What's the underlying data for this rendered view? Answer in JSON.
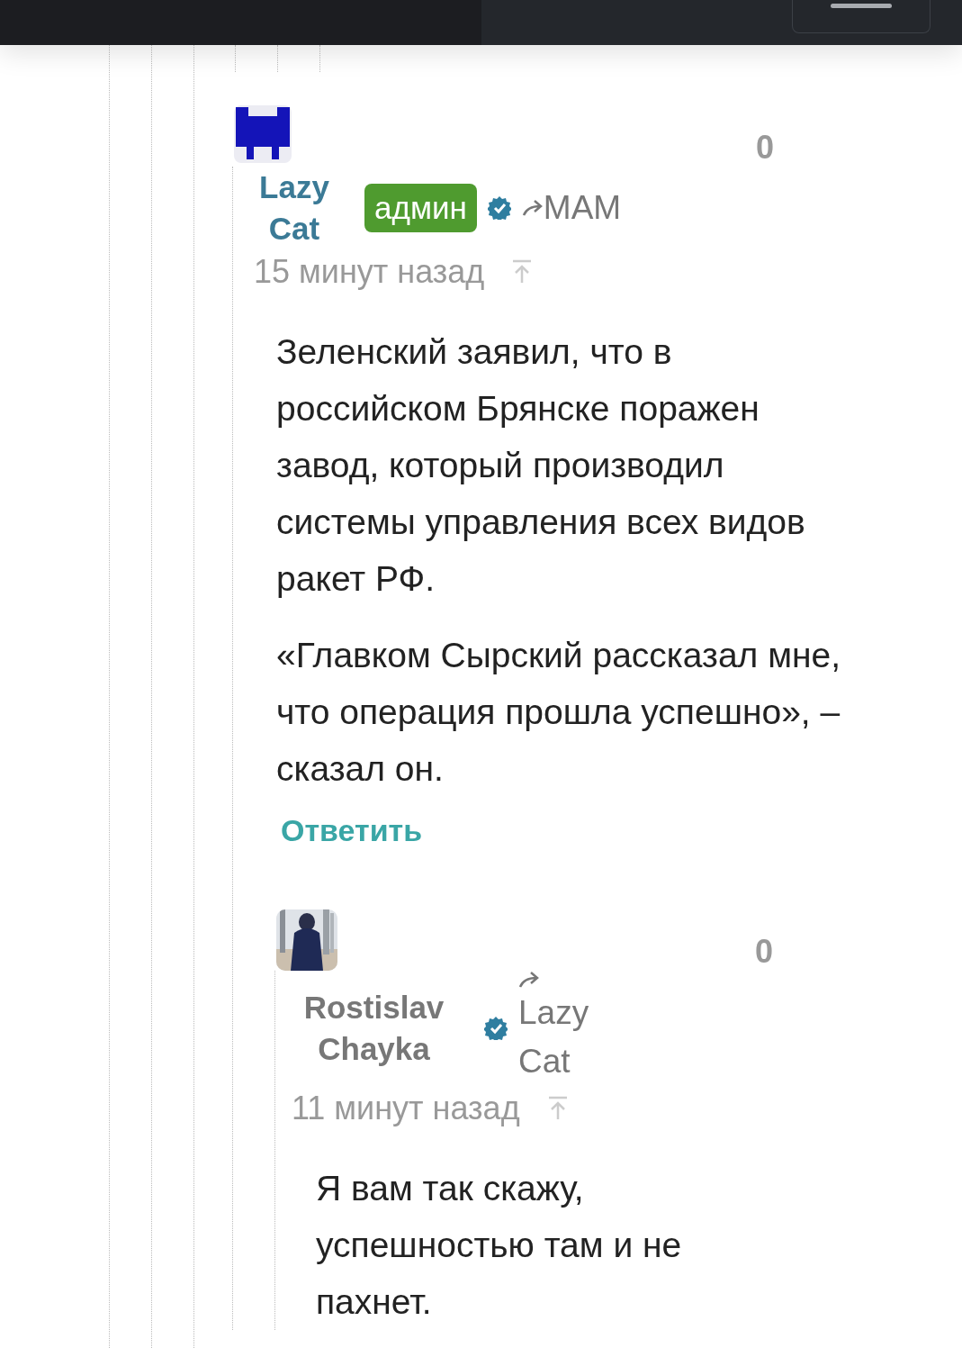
{
  "comments": [
    {
      "avatar": {
        "kind": "identicon"
      },
      "author": "Lazy Cat",
      "badge": "админ",
      "verified": true,
      "reply_to": "MAM",
      "time": "15 минут назад",
      "score": "0",
      "paragraphs": [
        "Зеленский заявил, что в российском Брянске поражен завод, который производил системы управления всех видов ракет РФ.",
        "«Главком Сырский рассказал мне, что операция прошла успешно», – сказал он."
      ],
      "reply_label": "Ответить",
      "children": [
        {
          "avatar": {
            "kind": "picture"
          },
          "author": "Rostislav Chayka",
          "verified": true,
          "reply_to": "Lazy Cat",
          "time": "11 минут назад",
          "score": "0",
          "paragraphs": [
            "Я вам так скажу, успешностью там и не пахнет."
          ]
        }
      ]
    }
  ]
}
